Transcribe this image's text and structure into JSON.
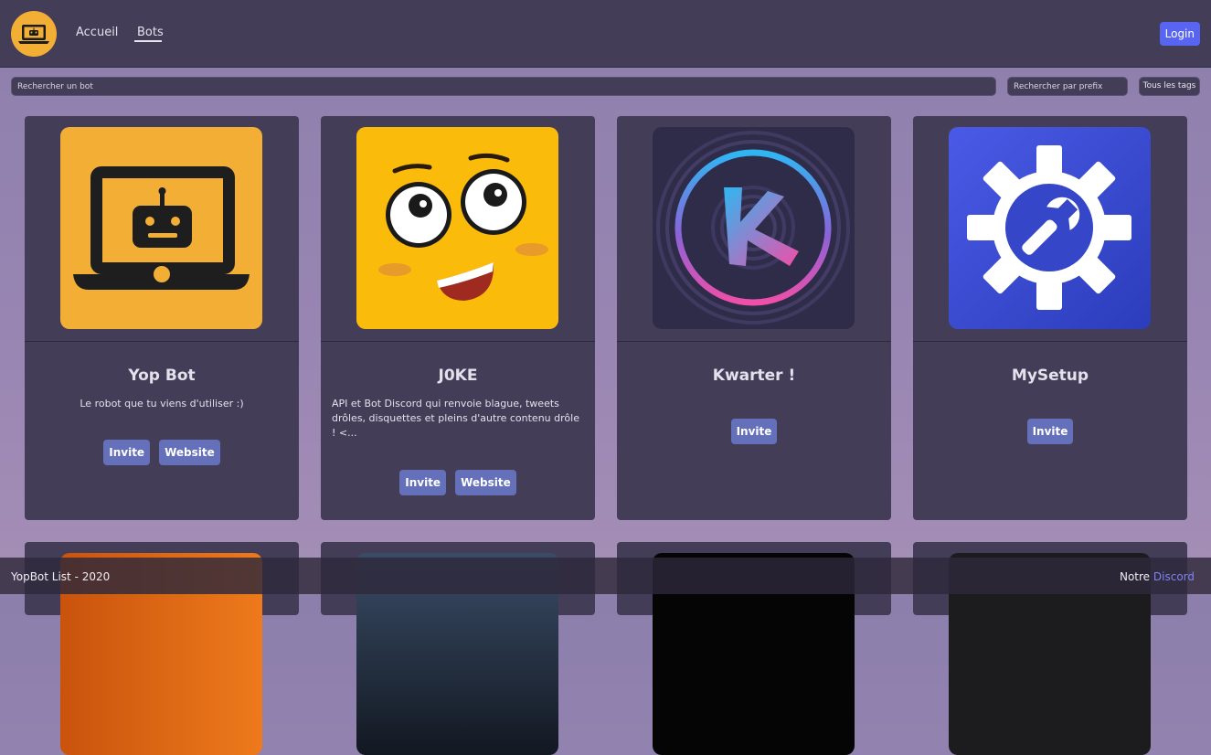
{
  "header": {
    "nav": {
      "home_label": "Accueil",
      "bots_label": "Bots"
    },
    "login_label": "Login"
  },
  "filters": {
    "search_placeholder": "Rechercher un bot",
    "prefix_placeholder": "Rechercher par prefix",
    "tags_label": "Tous les tags"
  },
  "bots": [
    {
      "name": "Yop Bot",
      "description": "Le robot que tu viens d'utiliser :)",
      "invite_label": "Invite",
      "website_label": "Website",
      "avatar_icon": "robot-laptop-icon"
    },
    {
      "name": "J0KE",
      "description": "API et Bot Discord qui renvoie blague, tweets drôles, disquettes et pleins d'autre contenu drôle ! <...",
      "invite_label": "Invite",
      "website_label": "Website",
      "avatar_icon": "smiley-face-icon"
    },
    {
      "name": "Kwarter !",
      "invite_label": "Invite",
      "avatar_icon": "k-ring-icon"
    },
    {
      "name": "MySetup",
      "invite_label": "Invite",
      "avatar_icon": "gear-wrench-icon"
    }
  ],
  "footer": {
    "copyright": "YopBot List - 2020",
    "our_label": "Notre",
    "discord_label": "Discord"
  },
  "colors": {
    "background": "#9483b0",
    "panel": "#443d58",
    "button": "#6470b9",
    "login": "#5865f2",
    "brand_orange": "#f3ae35"
  }
}
